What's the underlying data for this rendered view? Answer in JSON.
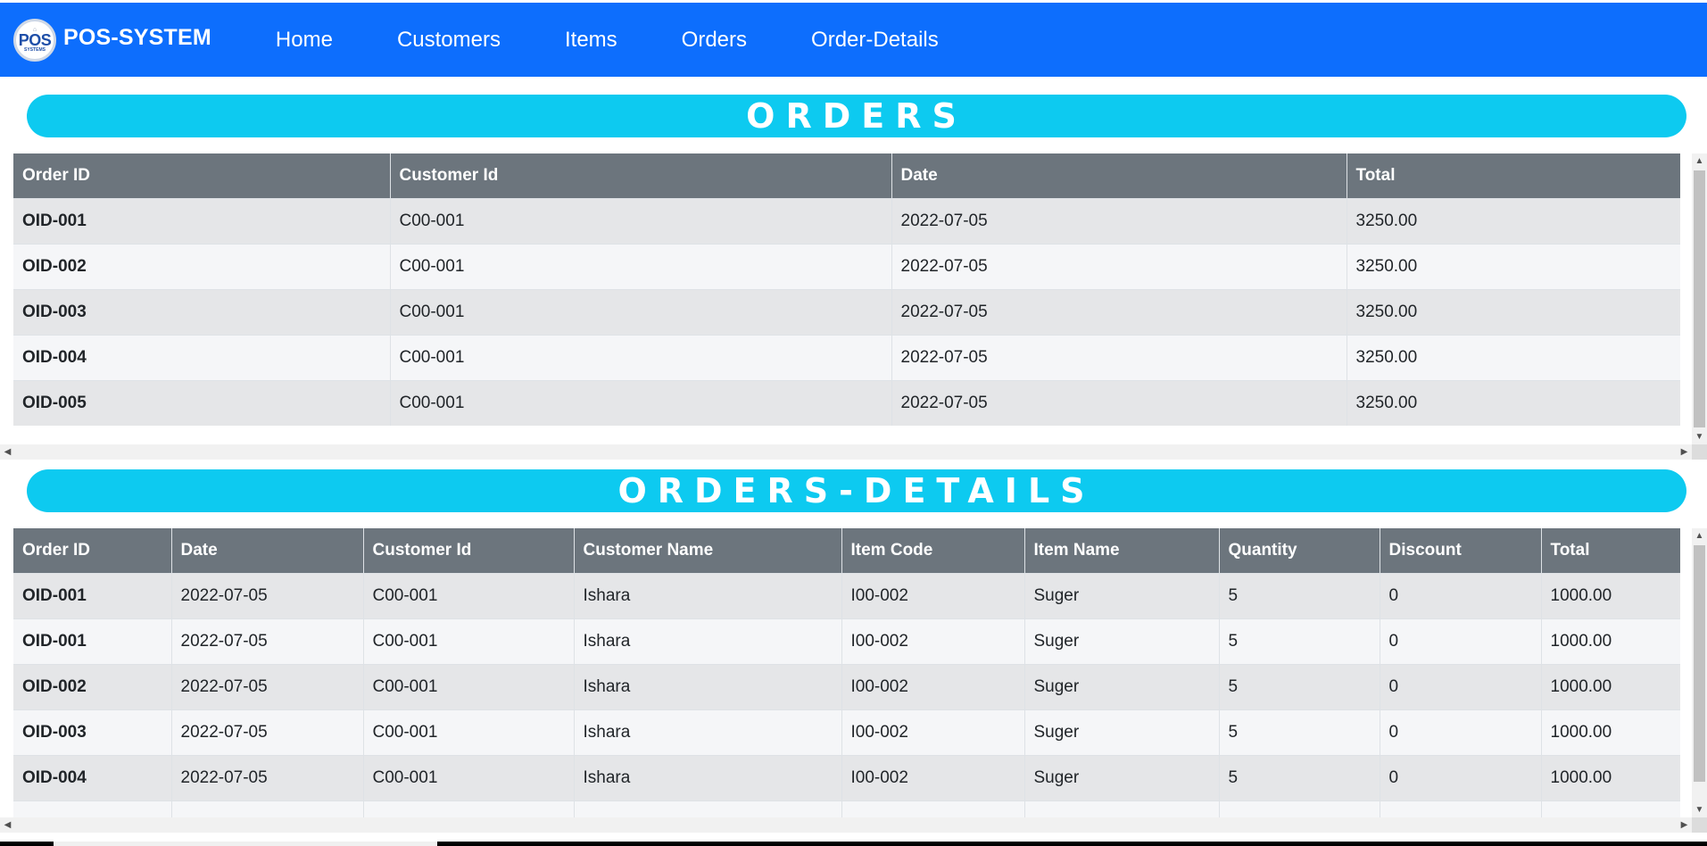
{
  "brand": {
    "logo_text": "POS",
    "logo_sub": "SYSTEMS",
    "name": "POS-SYSTEM"
  },
  "nav": [
    "Home",
    "Customers",
    "Items",
    "Orders",
    "Order-Details"
  ],
  "orders": {
    "title": "ORDERS",
    "columns": [
      "Order ID",
      "Customer Id",
      "Date",
      "Total"
    ],
    "rows": [
      [
        "OID-001",
        "C00-001",
        "2022-07-05",
        "3250.00"
      ],
      [
        "OID-002",
        "C00-001",
        "2022-07-05",
        "3250.00"
      ],
      [
        "OID-003",
        "C00-001",
        "2022-07-05",
        "3250.00"
      ],
      [
        "OID-004",
        "C00-001",
        "2022-07-05",
        "3250.00"
      ],
      [
        "OID-005",
        "C00-001",
        "2022-07-05",
        "3250.00"
      ]
    ]
  },
  "order_details": {
    "title": "ORDERS-DETAILS",
    "columns": [
      "Order ID",
      "Date",
      "Customer Id",
      "Customer Name",
      "Item Code",
      "Item Name",
      "Quantity",
      "Discount",
      "Total"
    ],
    "rows": [
      [
        "OID-001",
        "2022-07-05",
        "C00-001",
        "Ishara",
        "I00-002",
        "Suger",
        "5",
        "0",
        "1000.00"
      ],
      [
        "OID-001",
        "2022-07-05",
        "C00-001",
        "Ishara",
        "I00-002",
        "Suger",
        "5",
        "0",
        "1000.00"
      ],
      [
        "OID-002",
        "2022-07-05",
        "C00-001",
        "Ishara",
        "I00-002",
        "Suger",
        "5",
        "0",
        "1000.00"
      ],
      [
        "OID-003",
        "2022-07-05",
        "C00-001",
        "Ishara",
        "I00-002",
        "Suger",
        "5",
        "0",
        "1000.00"
      ],
      [
        "OID-004",
        "2022-07-05",
        "C00-001",
        "Ishara",
        "I00-002",
        "Suger",
        "5",
        "0",
        "1000.00"
      ],
      [
        "",
        "",
        "",
        "",
        "",
        "",
        "",
        "",
        ""
      ]
    ]
  },
  "colors": {
    "navbar": "#0d6efd",
    "title_pill": "#0dcaf0",
    "table_header": "#6c757d"
  }
}
